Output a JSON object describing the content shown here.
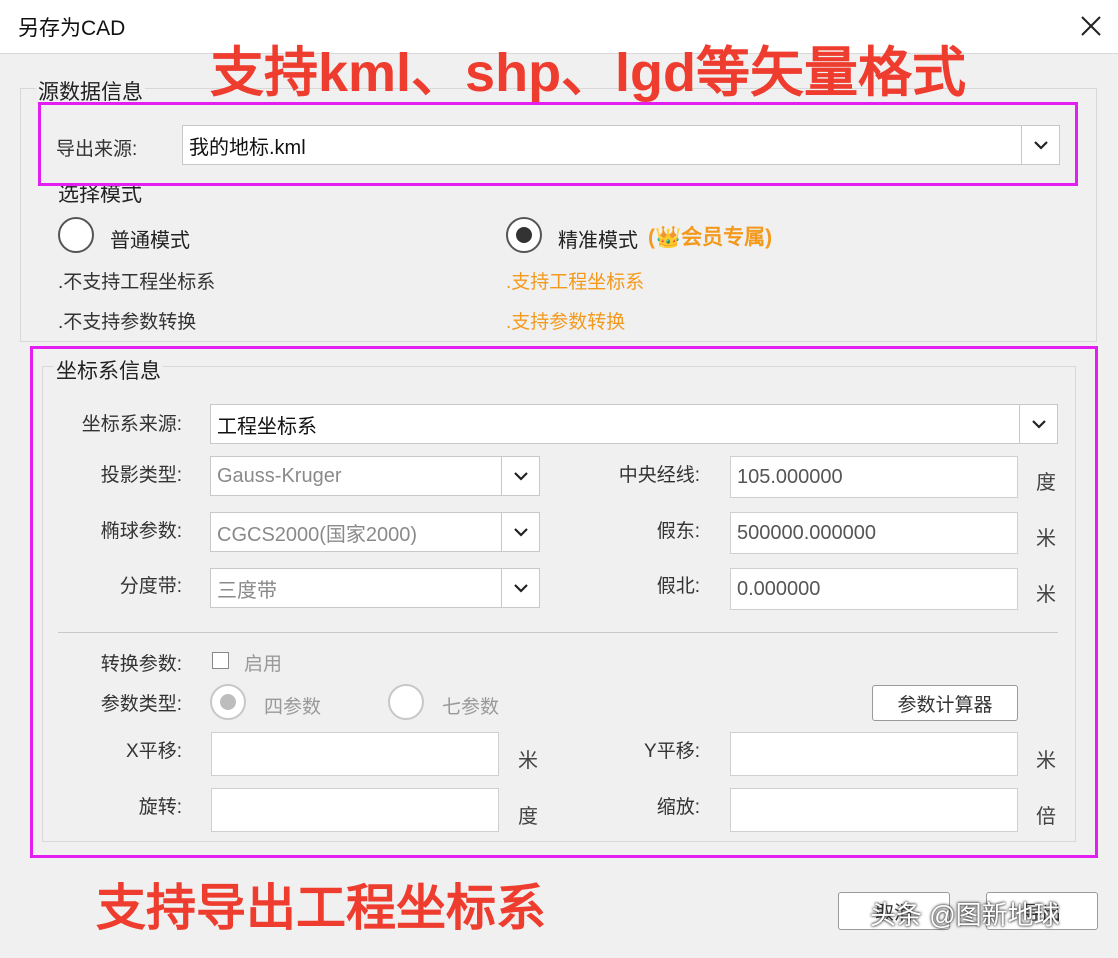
{
  "window": {
    "title": "另存为CAD"
  },
  "source_info": {
    "group_title": "源数据信息",
    "export_source_label": "导出来源:",
    "export_source_value": "我的地标.kml"
  },
  "mode": {
    "group_title": "选择模式",
    "normal_label": "普通模式",
    "precise_label": "精准模式",
    "member_badge": "(👑会员专属)",
    "normal_features": [
      ".不支持工程坐标系",
      ".不支持参数转换"
    ],
    "precise_features": [
      ".支持工程坐标系",
      ".支持参数转换"
    ],
    "selected": "precise"
  },
  "coord": {
    "group_title": "坐标系信息",
    "source_label": "坐标系来源:",
    "source_value": "工程坐标系",
    "projection_label": "投影类型:",
    "projection_value": "Gauss-Kruger",
    "ellipsoid_label": "椭球参数:",
    "ellipsoid_value": "CGCS2000(国家2000)",
    "zone_label": "分度带:",
    "zone_value": "三度带",
    "central_meridian_label": "中央经线:",
    "central_meridian_value": "105.000000",
    "central_meridian_unit": "度",
    "false_east_label": "假东:",
    "false_east_value": "500000.000000",
    "false_east_unit": "米",
    "false_north_label": "假北:",
    "false_north_value": "0.000000",
    "false_north_unit": "米"
  },
  "transform": {
    "params_label": "转换参数:",
    "enable_label": "启用",
    "type_label": "参数类型:",
    "four_label": "四参数",
    "seven_label": "七参数",
    "calculator_label": "参数计算器",
    "x_shift_label": "X平移:",
    "x_shift_unit": "米",
    "y_shift_label": "Y平移:",
    "y_shift_unit": "米",
    "rotation_label": "旋转:",
    "rotation_unit": "度",
    "scale_label": "缩放:",
    "scale_unit": "倍"
  },
  "buttons": {
    "cancel_label": "取消",
    "ok_label": "导出"
  },
  "annotations": {
    "top": "支持kml、shp、lgd等矢量格式",
    "bottom": "支持导出工程坐标系",
    "watermark": "头条 @图新地球"
  },
  "colors": {
    "annotation_border": "#e21ef0",
    "annotation_text": "#ee3c2e",
    "member_text": "#f39a1d"
  }
}
